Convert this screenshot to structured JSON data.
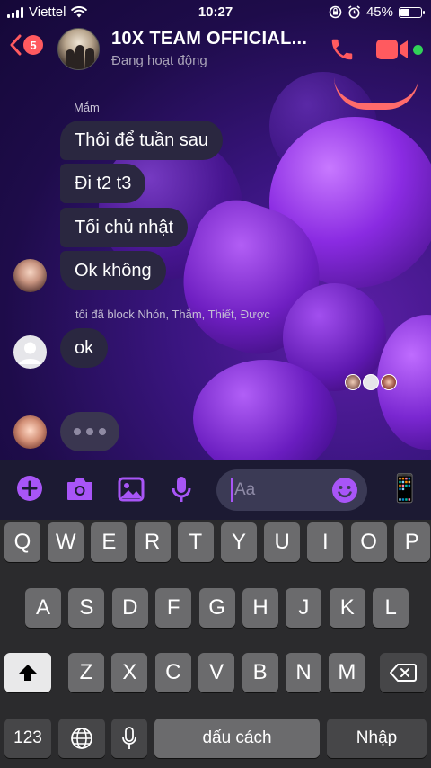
{
  "status_bar": {
    "carrier": "Viettel",
    "time": "10:27",
    "battery": "45%",
    "battery_level": 0.45
  },
  "header": {
    "back_badge": "5",
    "title": "10X TEAM OFFICIAL...",
    "subtitle": "Đang hoạt động",
    "accent_color": "#ff5a5f",
    "online_color": "#31d158"
  },
  "messages": {
    "sender_name": "Mắm",
    "group1": [
      "Thôi để tuần sau",
      "Đi t2 t3",
      "Tối chủ nhật",
      "Ok không"
    ],
    "system_note": "tôi đã block Nhón, Thắm, Thiết, Được",
    "group2": [
      "ok"
    ]
  },
  "composer": {
    "placeholder": "Aa",
    "accent_color": "#a855f7"
  },
  "keyboard": {
    "row1": [
      "Q",
      "W",
      "E",
      "R",
      "T",
      "Y",
      "U",
      "I",
      "O",
      "P"
    ],
    "row2": [
      "A",
      "S",
      "D",
      "F",
      "G",
      "H",
      "J",
      "K",
      "L"
    ],
    "row3": [
      "Z",
      "X",
      "C",
      "V",
      "B",
      "N",
      "M"
    ],
    "numbers_key": "123",
    "space_key": "dấu cách",
    "return_key": "Nhập"
  }
}
